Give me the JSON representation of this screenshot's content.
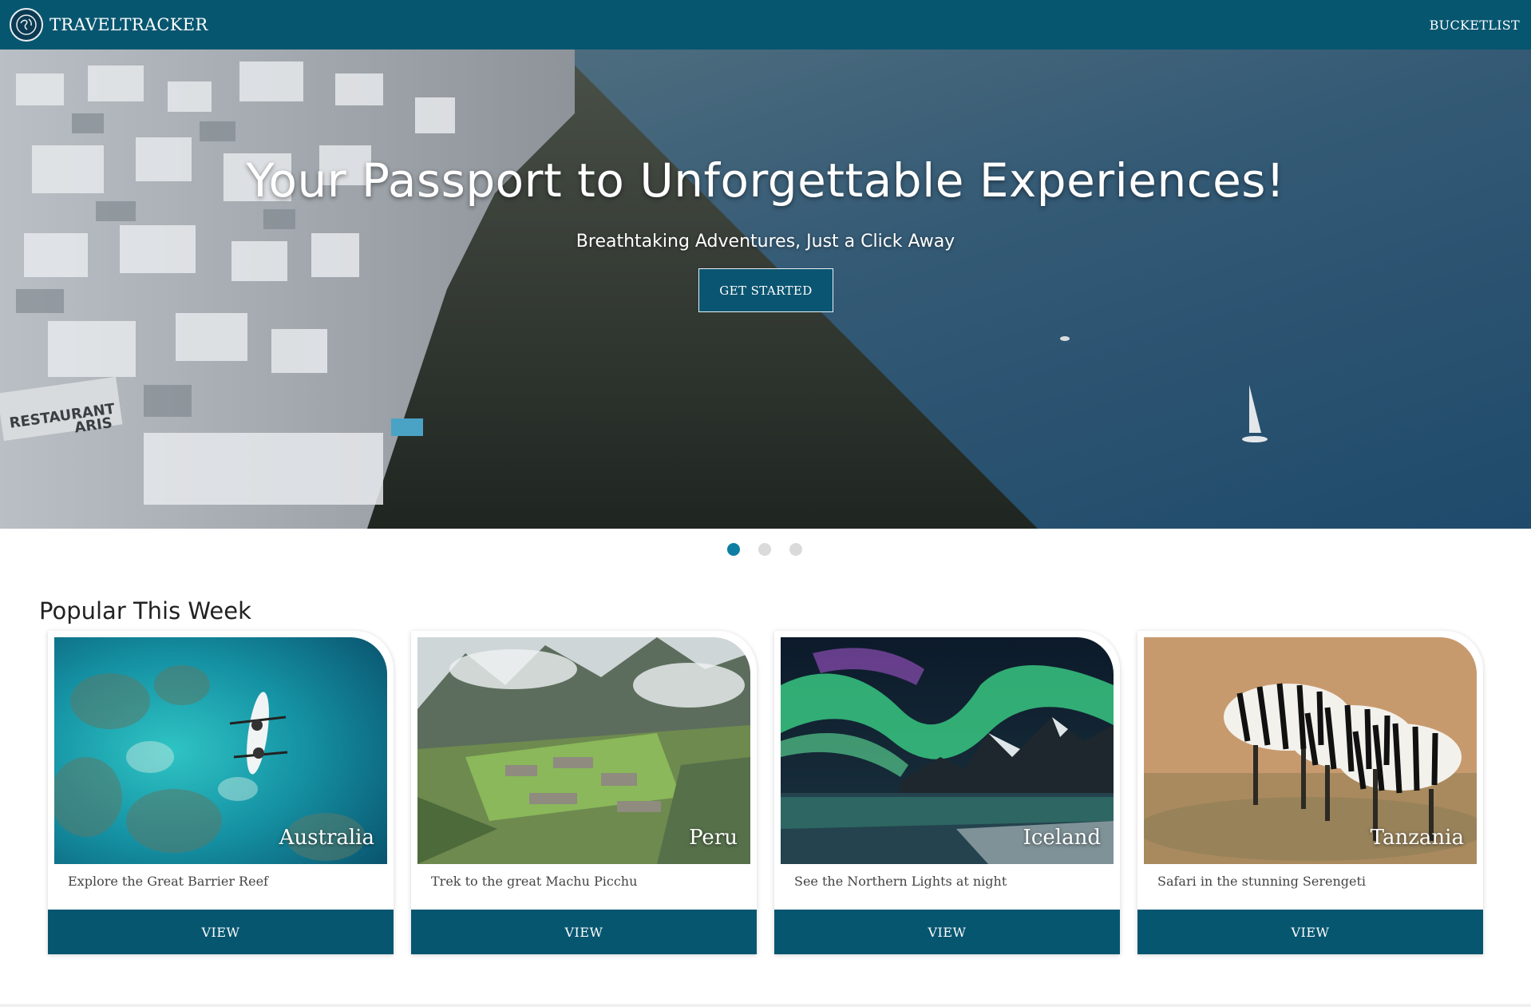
{
  "navbar": {
    "brand": "TRAVELTRACKER",
    "bucketlist_label": "BUCKETLIST"
  },
  "hero": {
    "title": "Your Passport to Unforgettable Experiences!",
    "subtitle": "Breathtaking Adventures, Just a Click Away",
    "cta_label": "GET STARTED",
    "slides_total": 3,
    "active_slide": 1
  },
  "popular": {
    "heading": "Popular This Week",
    "cards": [
      {
        "country": "Australia",
        "description": "Explore the Great Barrier Reef",
        "button": "VIEW"
      },
      {
        "country": "Peru",
        "description": "Trek to the great Machu Picchu",
        "button": "VIEW"
      },
      {
        "country": "Iceland",
        "description": "See the Northern Lights at night",
        "button": "VIEW"
      },
      {
        "country": "Tanzania",
        "description": "Safari in the stunning Serengeti",
        "button": "VIEW"
      }
    ]
  },
  "colors": {
    "primary": "#075670",
    "dot_active": "#0e7fa3",
    "dot_inactive": "#dadada"
  }
}
